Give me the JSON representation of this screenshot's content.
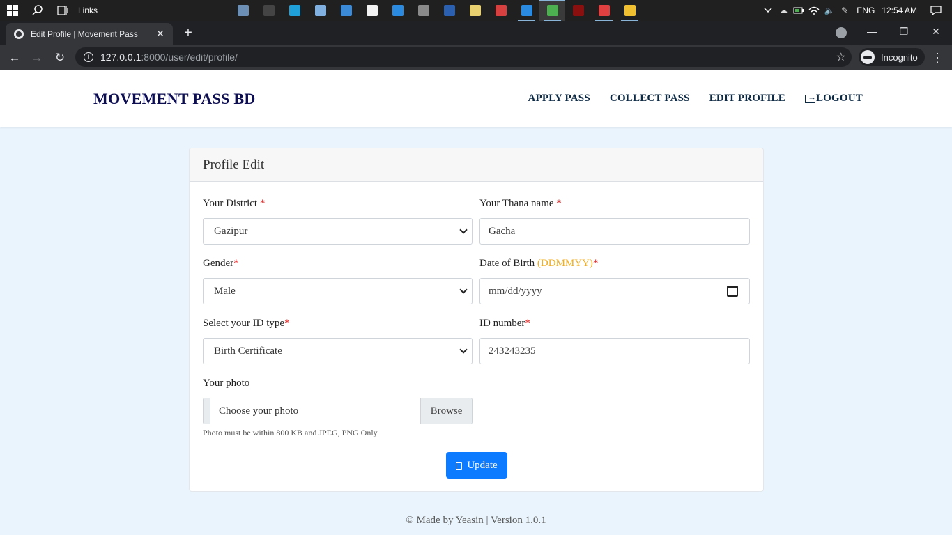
{
  "taskbar": {
    "links_label": "Links",
    "lang": "ENG",
    "time": "12:54 AM",
    "apps": [
      {
        "name": "photos-app-icon",
        "color": "#6b8fb5",
        "running": false
      },
      {
        "name": "terminal-app-icon",
        "color": "#444444",
        "running": false
      },
      {
        "name": "edge-app-icon",
        "color": "#1fa0d8",
        "running": false
      },
      {
        "name": "notepad-app-icon",
        "color": "#7fb0e0",
        "running": false
      },
      {
        "name": "desktop-app-icon",
        "color": "#3a8ad8",
        "running": false
      },
      {
        "name": "store-app-icon",
        "color": "#f2f2f2",
        "running": false
      },
      {
        "name": "mail-app-icon",
        "color": "#2a8ae0",
        "running": false
      },
      {
        "name": "calculator-app-icon",
        "color": "#8a8a8a",
        "running": false
      },
      {
        "name": "word-app-icon",
        "color": "#2b5fb0",
        "running": false
      },
      {
        "name": "notes-app-icon",
        "color": "#e8d070",
        "running": false
      },
      {
        "name": "paint-app-icon",
        "color": "#d84040",
        "running": false
      },
      {
        "name": "vscode-app-icon",
        "color": "#2a8ae0",
        "running": true
      },
      {
        "name": "chrome-app-icon",
        "color": "#4caf50",
        "running": true,
        "active": true
      },
      {
        "name": "media-app-icon",
        "color": "#8a1010",
        "running": false
      },
      {
        "name": "recorder-app-icon",
        "color": "#e04040",
        "running": true
      },
      {
        "name": "explorer-app-icon",
        "color": "#f0c030",
        "running": true
      }
    ]
  },
  "browser": {
    "tab_title": "Edit Profile | Movement Pass",
    "url_host": "127.0.0.1",
    "url_path": ":8000/user/edit/profile/",
    "incognito_label": "Incognito"
  },
  "navbar": {
    "brand": "MOVEMENT PASS BD",
    "links": [
      "APPLY PASS",
      "COLLECT PASS",
      "EDIT PROFILE",
      "LOGOUT"
    ]
  },
  "form": {
    "header": "Profile Edit",
    "district_label": "Your District",
    "district_value": "Gazipur",
    "thana_label": "Your Thana name",
    "thana_value": "Gacha",
    "gender_label": "Gender",
    "gender_value": "Male",
    "dob_label": "Date of Birth",
    "dob_hint": "(DDMMYY)",
    "dob_placeholder": "mm/dd/yyyy",
    "idtype_label": "Select your ID type",
    "idtype_value": "Birth Certificate",
    "idnumber_label": "ID number",
    "idnumber_value": "243243235",
    "photo_label": "Your photo",
    "photo_placeholder": "Choose your photo",
    "browse_label": "Browse",
    "photo_note": "Photo must be within 800 KB and JPEG, PNG Only",
    "required_mark": "*",
    "update_label": "Update"
  },
  "footer": {
    "text": "© Made by Yeasin | Version 1.0.1"
  },
  "colors": {
    "brand": "#0d0d52",
    "primary_button": "#0d7bff",
    "required": "#e02020",
    "hint": "#f0ad1e",
    "page_background": "#eaf4fc"
  }
}
